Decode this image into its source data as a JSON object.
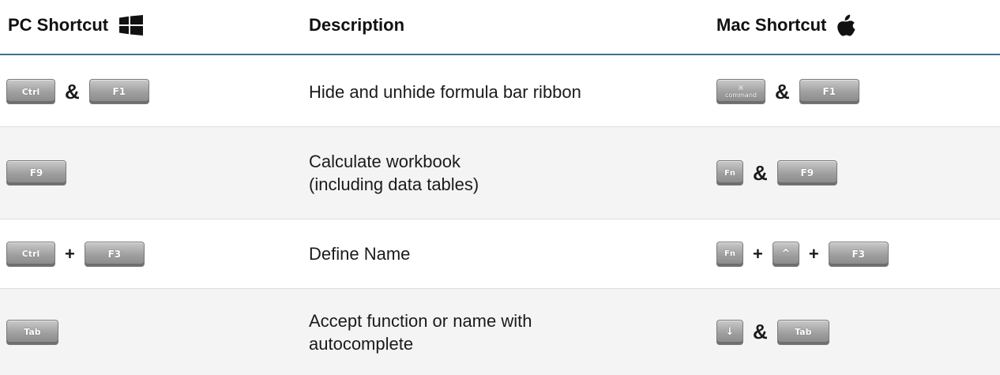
{
  "header": {
    "pc": "PC Shortcut",
    "desc": "Description",
    "mac": "Mac Shortcut"
  },
  "rows": [
    {
      "pc": {
        "k1": "Ctrl",
        "sep": "&",
        "k2": "F1"
      },
      "desc": "Hide and unhide formula bar ribbon",
      "mac": {
        "k1_sym": "⌘",
        "k1_text": "command",
        "sep": "&",
        "k2": "F1"
      }
    },
    {
      "pc": {
        "k1": "F9"
      },
      "desc": "Calculate workbook\n(including data tables)",
      "mac": {
        "k1": "Fn",
        "sep": "&",
        "k2": "F9"
      }
    },
    {
      "pc": {
        "k1": "Ctrl",
        "sep": "+",
        "k2": "F3"
      },
      "desc": "Define Name",
      "mac": {
        "k1": "Fn",
        "sep1": "+",
        "k2": "^",
        "sep2": "+",
        "k3": "F3"
      }
    },
    {
      "pc": {
        "k1": "Tab"
      },
      "desc": "Accept function or name with\nautocomplete",
      "mac": {
        "k1": "↓",
        "sep": "&",
        "k2": "Tab"
      }
    }
  ]
}
